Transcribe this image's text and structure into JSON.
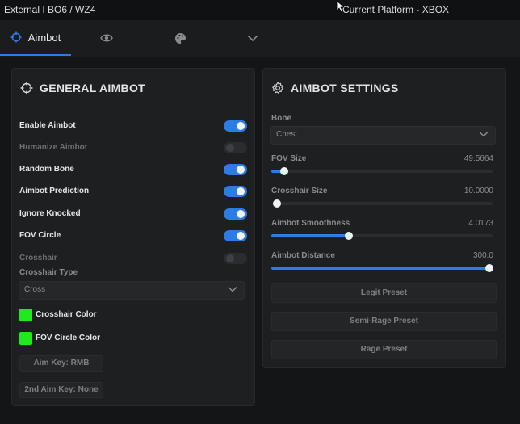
{
  "window": {
    "title": "External I BO6 / WZ4",
    "platform": "Current Platform - XBOX"
  },
  "tabs": [
    {
      "label": "Aimbot",
      "icon": "crosshair-icon",
      "active": true
    },
    {
      "label": "",
      "icon": "eye-icon",
      "active": false
    },
    {
      "label": "",
      "icon": "palette-icon",
      "active": false
    },
    {
      "label": "",
      "icon": "chevron-down-icon",
      "active": false
    }
  ],
  "general": {
    "title": "GENERAL AIMBOT",
    "toggles": [
      {
        "label": "Enable Aimbot",
        "on": true,
        "enabled": true
      },
      {
        "label": "Humanize Aimbot",
        "on": false,
        "enabled": false
      },
      {
        "label": "Random Bone",
        "on": true,
        "enabled": true
      },
      {
        "label": "Aimbot Prediction",
        "on": true,
        "enabled": true
      },
      {
        "label": "Ignore Knocked",
        "on": true,
        "enabled": true
      },
      {
        "label": "FOV Circle",
        "on": true,
        "enabled": true
      },
      {
        "label": "Crosshair",
        "on": false,
        "enabled": false
      }
    ],
    "crosshair_type_label": "Crosshair Type",
    "crosshair_type_value": "Cross",
    "crosshair_color_label": "Crosshair Color",
    "crosshair_color": "#1eea1e",
    "fov_circle_color_label": "FOV Circle Color",
    "fov_circle_color": "#1eea1e",
    "aim_key": "Aim Key: RMB",
    "aim_key2": "2nd Aim Key: None"
  },
  "settings": {
    "title": "AIMBOT SETTINGS",
    "bone_label": "Bone",
    "bone_value": "Chest",
    "sliders": [
      {
        "label": "FOV Size",
        "value": "49.5664",
        "fraction": 0.06
      },
      {
        "label": "Crosshair Size",
        "value": "10.0000",
        "fraction": 0.0
      },
      {
        "label": "Aimbot Smoothness",
        "value": "4.0173",
        "fraction": 0.35
      },
      {
        "label": "Aimbot Distance",
        "value": "300.0",
        "fraction": 1.0
      }
    ],
    "presets": [
      "Legit Preset",
      "Semi-Rage Preset",
      "Rage Preset"
    ]
  },
  "colors": {
    "accent": "#2d7be5",
    "swatch": "#1eea1e"
  }
}
